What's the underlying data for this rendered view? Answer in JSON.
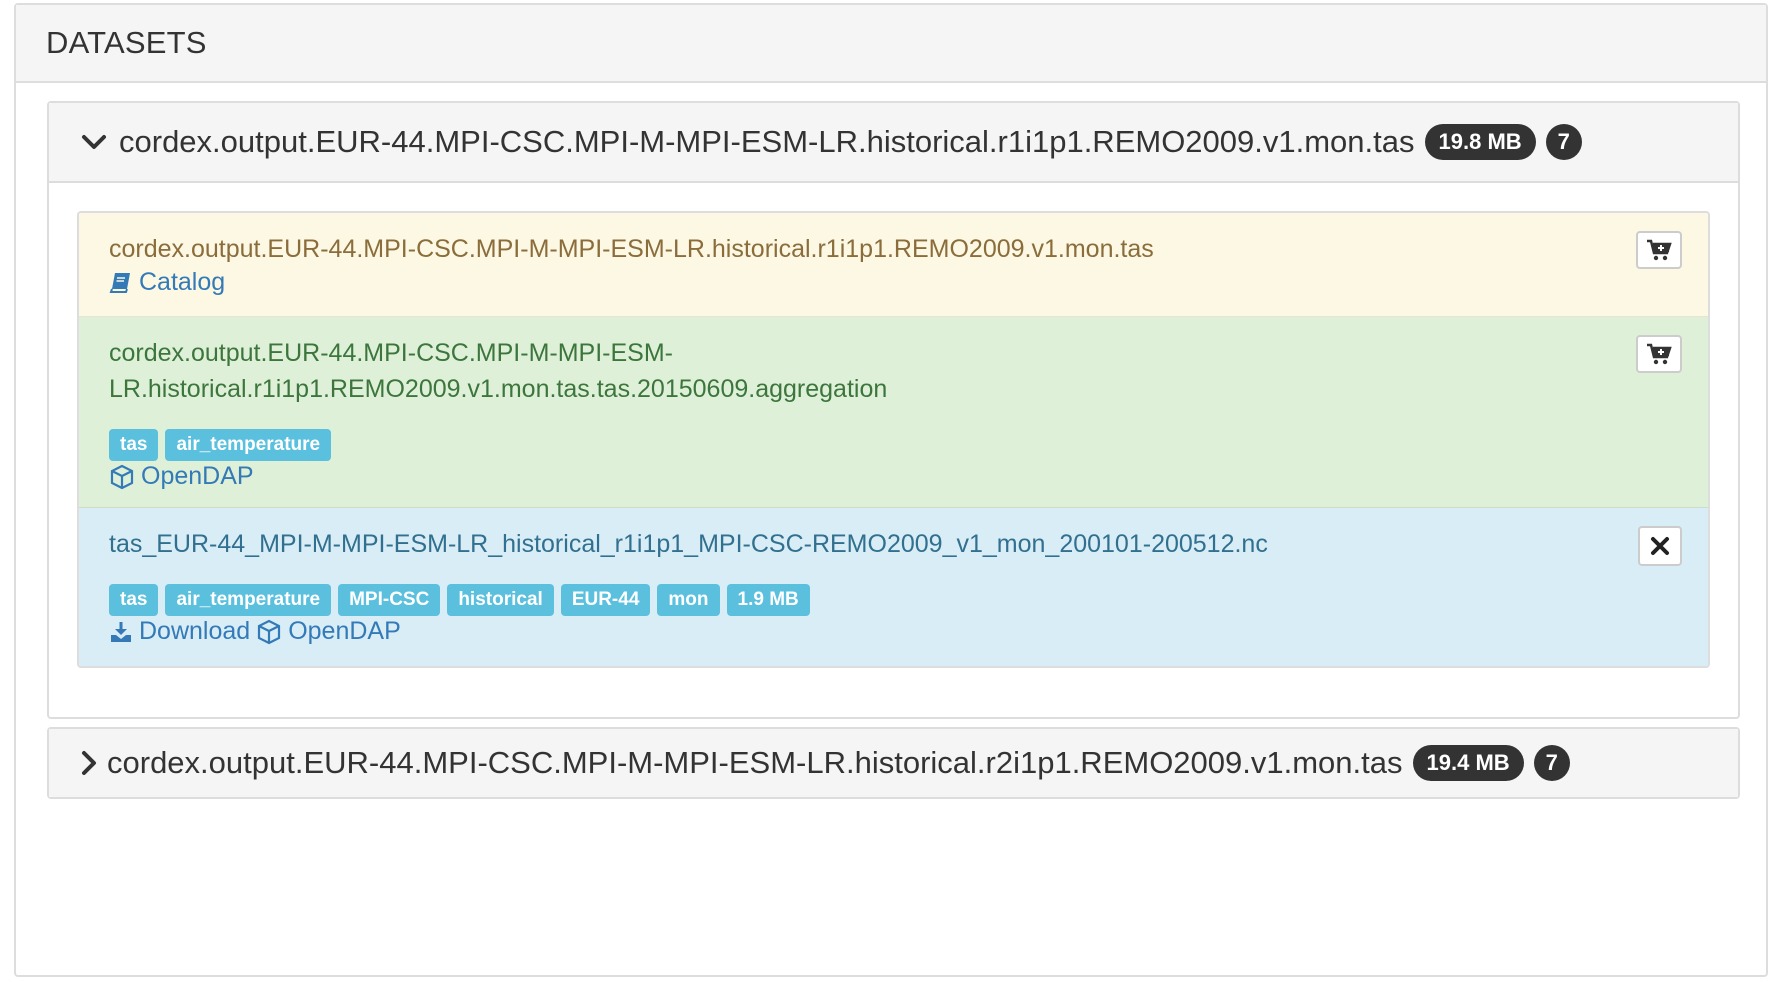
{
  "outer": {
    "title": "DATASETS"
  },
  "datasets": [
    {
      "name": "cordex.output.EUR-44.MPI-CSC.MPI-M-MPI-ESM-LR.historical.r1i1p1.REMO2009.v1.mon.tas",
      "size": "19.8 MB",
      "count": "7",
      "expanded": true,
      "items": [
        {
          "kind": "catalog",
          "title": "cordex.output.EUR-44.MPI-CSC.MPI-M-MPI-ESM-LR.historical.r1i1p1.REMO2009.v1.mon.tas",
          "links": [
            "Catalog"
          ],
          "action_icon": "cart-plus-icon"
        },
        {
          "kind": "aggregation",
          "title": "cordex.output.EUR-44.MPI-CSC.MPI-M-MPI-ESM-LR.historical.r1i1p1.REMO2009.v1.mon.tas.tas.20150609.aggregation",
          "labels": [
            "tas",
            "air_temperature"
          ],
          "links": [
            "OpenDAP"
          ],
          "action_icon": "cart-plus-icon"
        },
        {
          "kind": "file",
          "title": "tas_EUR-44_MPI-M-MPI-ESM-LR_historical_r1i1p1_MPI-CSC-REMO2009_v1_mon_200101-200512.nc",
          "labels": [
            "tas",
            "air_temperature",
            "MPI-CSC",
            "historical",
            "EUR-44",
            "mon",
            "1.9 MB"
          ],
          "links": [
            "Download",
            "OpenDAP"
          ],
          "action_icon": "close-icon"
        }
      ]
    },
    {
      "name": "cordex.output.EUR-44.MPI-CSC.MPI-M-MPI-ESM-LR.historical.r2i1p1.REMO2009.v1.mon.tas",
      "size": "19.4 MB",
      "count": "7",
      "expanded": false
    }
  ],
  "colors": {
    "warning_bg": "#fcf8e3",
    "warning_text": "#8a6d3b",
    "success_bg": "#dff0d8",
    "success_text": "#3c763d",
    "info_bg": "#d9edf7",
    "info_text": "#31708f",
    "label_bg": "#5bc0de",
    "link": "#337ab7",
    "badge_bg": "#333333"
  }
}
